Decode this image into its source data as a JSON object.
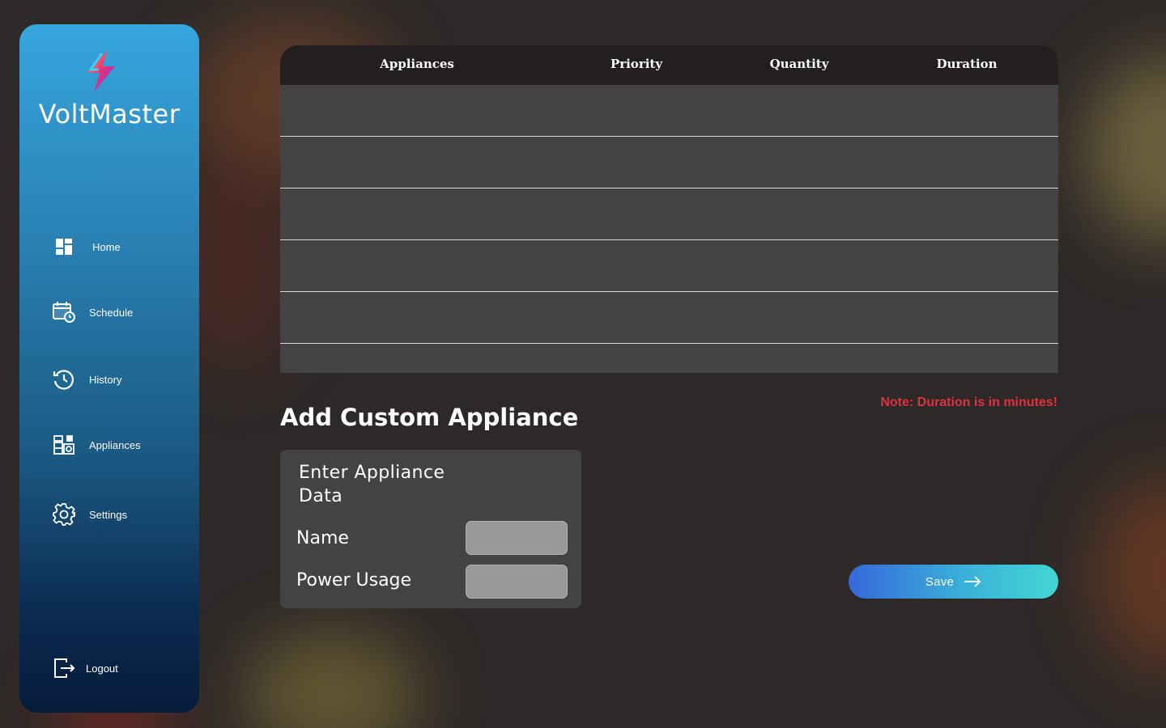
{
  "brand": {
    "name": "VoltMaster",
    "logo_icon": "lightning-bolt-icon"
  },
  "sidebar": {
    "items": [
      {
        "label": "Home",
        "icon": "dashboard-icon"
      },
      {
        "label": "Schedule",
        "icon": "calendar-clock-icon"
      },
      {
        "label": "History",
        "icon": "history-icon"
      },
      {
        "label": "Appliances",
        "icon": "appliances-icon"
      },
      {
        "label": "Settings",
        "icon": "gear-icon"
      }
    ],
    "logout": {
      "label": "Logout",
      "icon": "logout-icon"
    }
  },
  "table": {
    "columns": [
      "Appliances",
      "Priority",
      "Quantity",
      "Duration"
    ],
    "rows": [
      [],
      [],
      [],
      [],
      [],
      []
    ]
  },
  "note": "Note: Duration is in minutes!",
  "custom_appliance": {
    "title": "Add Custom Appliance",
    "form_title": "Enter Appliance Data",
    "fields": [
      {
        "label": "Name",
        "value": ""
      },
      {
        "label": "Power Usage",
        "value": ""
      }
    ]
  },
  "save_button": {
    "label": "Save",
    "icon": "arrow-right-icon"
  },
  "colors": {
    "note": "#e0323c",
    "accent_start": "#3568db",
    "accent_end": "#43d6d4"
  }
}
